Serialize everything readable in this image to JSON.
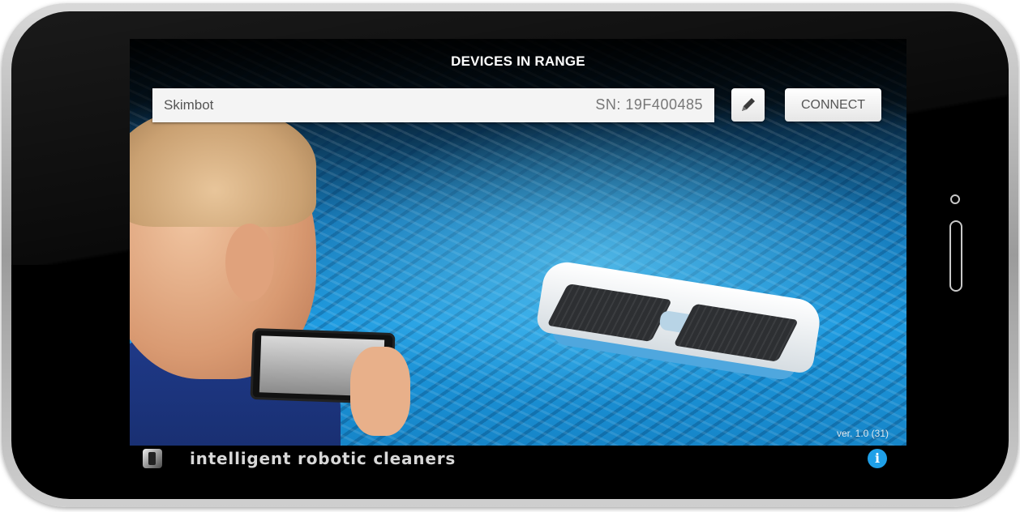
{
  "header": {
    "title": "DEVICES IN RANGE"
  },
  "devices": [
    {
      "name": "Skimbot",
      "serial": "SN: 19F400485"
    }
  ],
  "actions": {
    "edit_icon": "pencil-icon",
    "connect_label": "CONNECT"
  },
  "footer": {
    "version": "ver. 1.0 (31)",
    "brand_text": "intelligent robotic cleaners",
    "logo_icon": "brand-logo-icon",
    "info_icon": "info-icon",
    "info_glyph": "i"
  },
  "colors": {
    "accent": "#1fa0e8",
    "button_bg": "#f4f4f4",
    "title_text": "#ffffff"
  }
}
